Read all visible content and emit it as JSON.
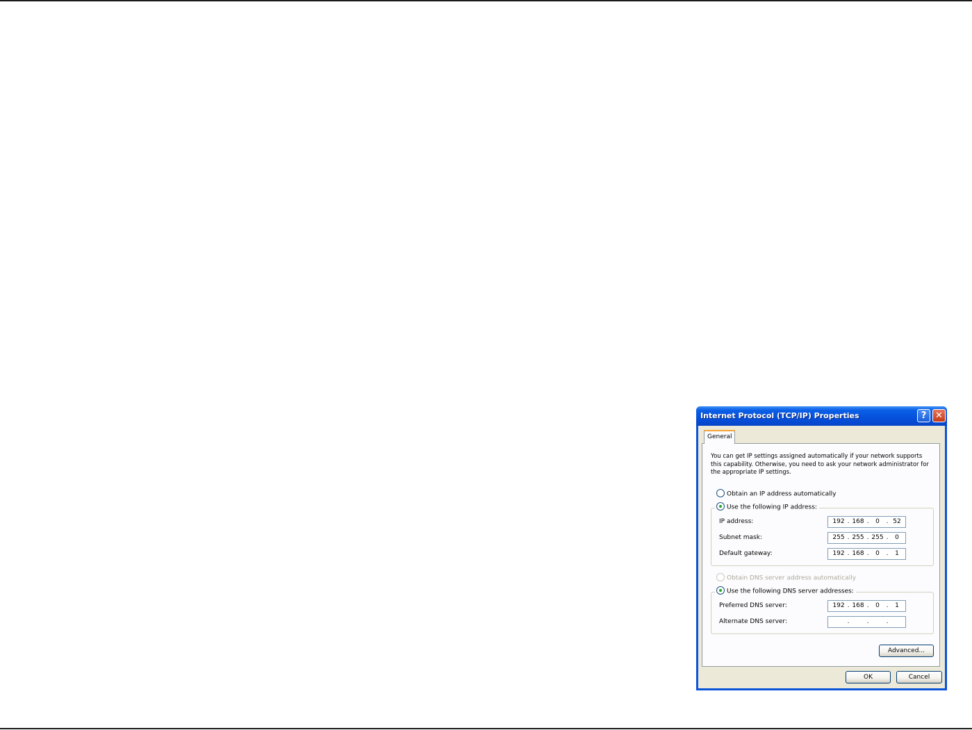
{
  "dialog": {
    "title": "Internet Protocol (TCP/IP) Properties",
    "help_glyph": "?",
    "close_glyph": "✕",
    "tab_general": "General",
    "intro_text": "You can get IP settings assigned automatically if your network supports this capability. Otherwise, you need to ask your network administrator for the appropriate IP settings.",
    "radio_obtain_ip": {
      "label": "Obtain an IP address automatically",
      "checked": false
    },
    "radio_use_ip": {
      "label": "Use the following IP address:",
      "checked": true
    },
    "ip_address": {
      "label": "IP address:",
      "octets": [
        "192",
        "168",
        "0",
        "52"
      ]
    },
    "subnet_mask": {
      "label": "Subnet mask:",
      "octets": [
        "255",
        "255",
        "255",
        "0"
      ]
    },
    "default_gateway": {
      "label": "Default gateway:",
      "octets": [
        "192",
        "168",
        "0",
        "1"
      ]
    },
    "radio_obtain_dns": {
      "label": "Obtain DNS server address automatically",
      "checked": false,
      "disabled": true
    },
    "radio_use_dns": {
      "label": "Use the following DNS server addresses:",
      "checked": true
    },
    "preferred_dns": {
      "label": "Preferred DNS server:",
      "octets": [
        "192",
        "168",
        "0",
        "1"
      ]
    },
    "alternate_dns": {
      "label": "Alternate DNS server:",
      "octets": [
        "",
        "",
        "",
        ""
      ]
    },
    "advanced_button": "Advanced...",
    "ok_button": "OK",
    "cancel_button": "Cancel"
  },
  "colors": {
    "titlebar": "#0650dc",
    "dialog_face": "#ece9d8",
    "tab_panel": "#fcfcfe",
    "radio_dot": "#21a121"
  }
}
